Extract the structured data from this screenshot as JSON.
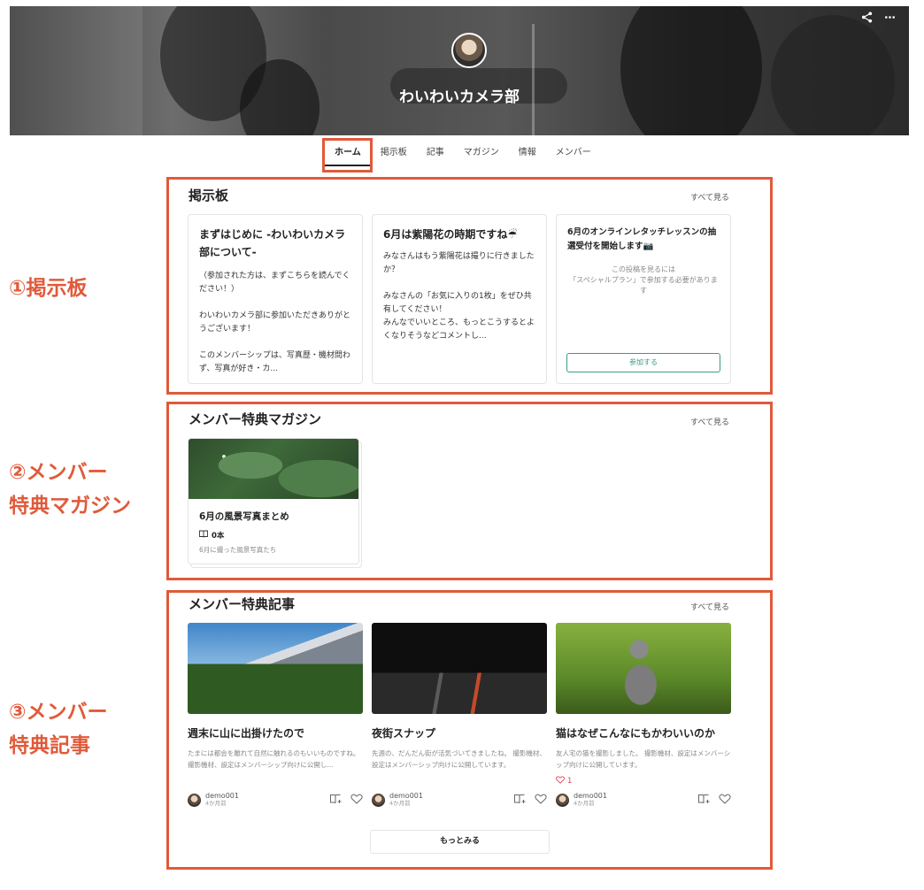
{
  "hero": {
    "club_name": "わいわいカメラ部",
    "share_icon": "share-icon",
    "more_icon": "more-horizontal-icon"
  },
  "tabs": [
    {
      "label": "ホーム",
      "active": true
    },
    {
      "label": "掲示板",
      "active": false
    },
    {
      "label": "記事",
      "active": false
    },
    {
      "label": "マガジン",
      "active": false
    },
    {
      "label": "情報",
      "active": false
    },
    {
      "label": "メンバー",
      "active": false
    }
  ],
  "annotations": {
    "board": "①掲示板",
    "magazine_line1": "②メンバー",
    "magazine_line2": "特典マガジン",
    "articles_line1": "③メンバー",
    "articles_line2": "特典記事"
  },
  "board": {
    "title": "掲示板",
    "see_all": "すべて見る",
    "posts": [
      {
        "title": "まずはじめに -わいわいカメラ部について-",
        "body": "（参加された方は、まずこちらを読んでください！）\n\nわいわいカメラ部に参加いただきありがとうございます！\n\nこのメンバーシップは、写真歴・機材問わず、写真が好き・カ..."
      },
      {
        "title": "6月は紫陽花の時期ですね☔",
        "body": "みなさんはもう紫陽花は撮りに行きましたか？\n\nみなさんの「お気に入りの1枚」をぜひ共有してください！\nみんなでいいところ、もっとこうするとよくなりそうなどコメントし..."
      },
      {
        "title": "6月のオンラインレタッチレッスンの抽選受付を開始します📷",
        "locked_text": "この投稿を見るには\n「スペシャルプラン」で参加する必要があります",
        "join_label": "参加する"
      }
    ]
  },
  "magazine": {
    "title": "メンバー特典マガジン",
    "see_all": "すべて見る",
    "item": {
      "title": "6月の風景写真まとめ",
      "count": "0本",
      "description": "6月に撮った風景写真たち"
    }
  },
  "articles": {
    "title": "メンバー特典記事",
    "see_all": "すべて見る",
    "items": [
      {
        "title": "週末に山に出掛けたので",
        "description": "たまには都会を離れて自然に触れるのもいいものですね。 撮影機材、設定はメンバーシップ向けに公開し...",
        "author": "demo001",
        "time": "4か月前",
        "likes": ""
      },
      {
        "title": "夜街スナップ",
        "description": "先週の、だんだん街が活気づいてきましたね。 撮影機材、設定はメンバーシップ向けに公開しています。",
        "author": "demo001",
        "time": "4か月前",
        "likes": ""
      },
      {
        "title": "猫はなぜこんなにもかわいいのか",
        "description": "友人宅の猫を撮影しました。 撮影機材、設定はメンバーシップ向けに公開しています。",
        "author": "demo001",
        "time": "4か月前",
        "likes": "1"
      }
    ],
    "more_label": "もっとみる"
  },
  "colors": {
    "annotation": "#e05a3a",
    "join_button": "#3a9b86",
    "like": "#e0455a"
  }
}
